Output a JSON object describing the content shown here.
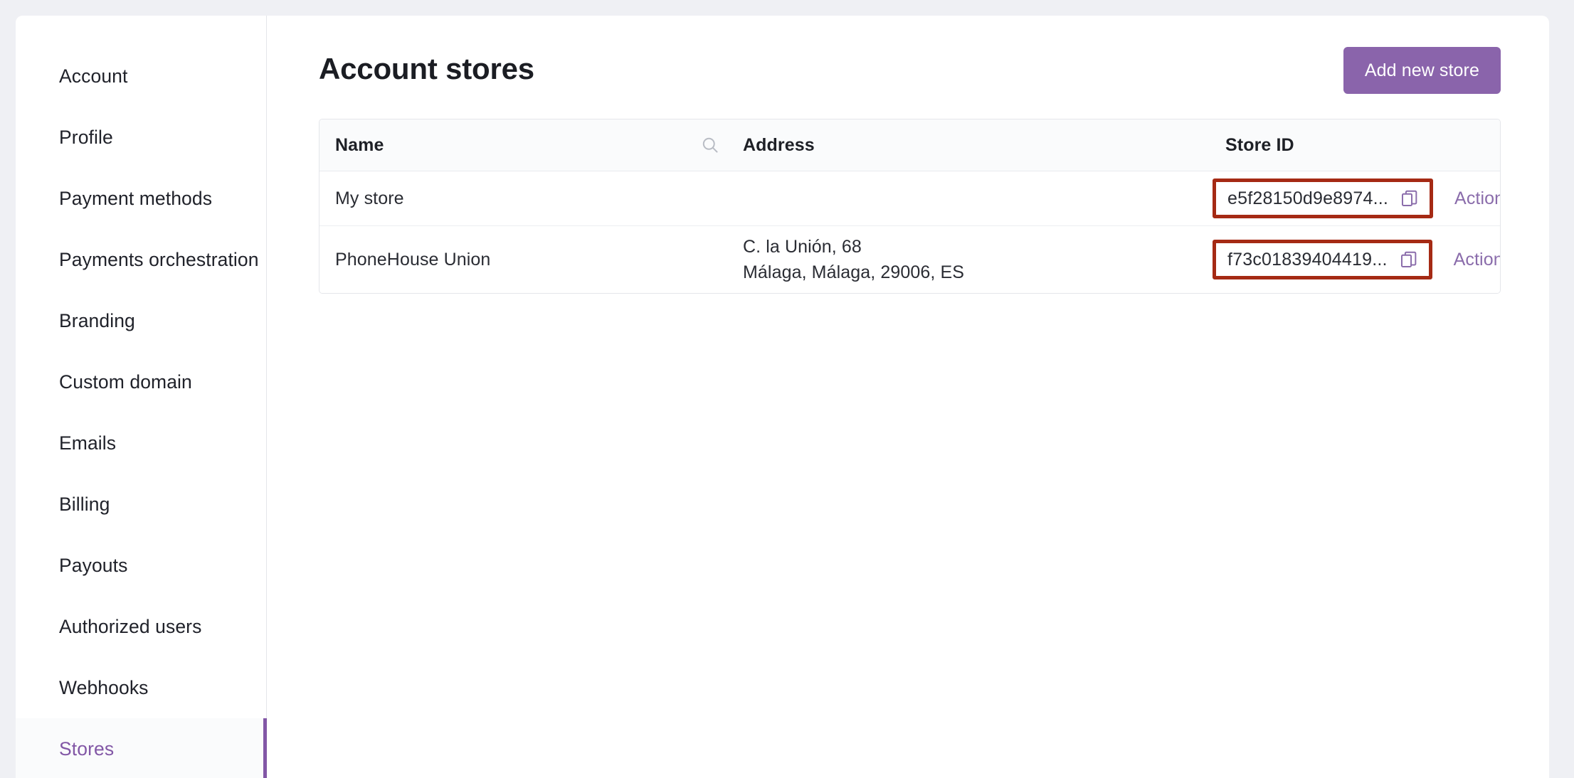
{
  "sidebar": {
    "items": [
      {
        "label": "Account",
        "active": false
      },
      {
        "label": "Profile",
        "active": false
      },
      {
        "label": "Payment methods",
        "active": false
      },
      {
        "label": "Payments orchestration",
        "active": false
      },
      {
        "label": "Branding",
        "active": false
      },
      {
        "label": "Custom domain",
        "active": false
      },
      {
        "label": "Emails",
        "active": false
      },
      {
        "label": "Billing",
        "active": false
      },
      {
        "label": "Payouts",
        "active": false
      },
      {
        "label": "Authorized users",
        "active": false
      },
      {
        "label": "Webhooks",
        "active": false
      },
      {
        "label": "Stores",
        "active": true
      }
    ]
  },
  "header": {
    "title": "Account stores",
    "add_store_label": "Add new store"
  },
  "table": {
    "columns": {
      "name": "Name",
      "address": "Address",
      "store_id": "Store ID"
    },
    "search_icon": "search-icon",
    "rows": [
      {
        "name": "My store",
        "address_line1": "",
        "address_line2": "",
        "store_id": "e5f28150d9e8974...",
        "copy_icon": "copy-icon",
        "actions_label": "Actions",
        "actions_chevron": "chevron-down-icon",
        "annotated": true
      },
      {
        "name": "PhoneHouse Union",
        "address_line1": "C. la Unión, 68",
        "address_line2": "Málaga, Málaga, 29006, ES",
        "store_id": "f73c01839404419...",
        "copy_icon": "copy-icon",
        "actions_label": "Actions",
        "actions_chevron": "chevron-down-icon",
        "annotated": true
      }
    ]
  },
  "colors": {
    "page_background": "#eff0f4",
    "accent_purple": "#8a64ab",
    "active_nav": "#8257a6",
    "annotation_red": "#a52a14",
    "border": "#e4e6ea",
    "header_row": "#fafbfc",
    "text_primary": "#1e2026"
  }
}
